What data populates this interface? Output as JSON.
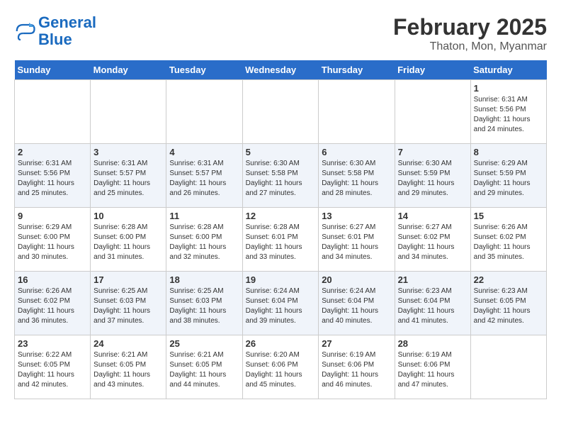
{
  "header": {
    "logo_line1": "General",
    "logo_line2": "Blue",
    "month": "February 2025",
    "location": "Thaton, Mon, Myanmar"
  },
  "days_of_week": [
    "Sunday",
    "Monday",
    "Tuesday",
    "Wednesday",
    "Thursday",
    "Friday",
    "Saturday"
  ],
  "weeks": [
    [
      {
        "day": "",
        "info": ""
      },
      {
        "day": "",
        "info": ""
      },
      {
        "day": "",
        "info": ""
      },
      {
        "day": "",
        "info": ""
      },
      {
        "day": "",
        "info": ""
      },
      {
        "day": "",
        "info": ""
      },
      {
        "day": "1",
        "info": "Sunrise: 6:31 AM\nSunset: 5:56 PM\nDaylight: 11 hours and 24 minutes."
      }
    ],
    [
      {
        "day": "2",
        "info": "Sunrise: 6:31 AM\nSunset: 5:56 PM\nDaylight: 11 hours and 25 minutes."
      },
      {
        "day": "3",
        "info": "Sunrise: 6:31 AM\nSunset: 5:57 PM\nDaylight: 11 hours and 25 minutes."
      },
      {
        "day": "4",
        "info": "Sunrise: 6:31 AM\nSunset: 5:57 PM\nDaylight: 11 hours and 26 minutes."
      },
      {
        "day": "5",
        "info": "Sunrise: 6:30 AM\nSunset: 5:58 PM\nDaylight: 11 hours and 27 minutes."
      },
      {
        "day": "6",
        "info": "Sunrise: 6:30 AM\nSunset: 5:58 PM\nDaylight: 11 hours and 28 minutes."
      },
      {
        "day": "7",
        "info": "Sunrise: 6:30 AM\nSunset: 5:59 PM\nDaylight: 11 hours and 29 minutes."
      },
      {
        "day": "8",
        "info": "Sunrise: 6:29 AM\nSunset: 5:59 PM\nDaylight: 11 hours and 29 minutes."
      }
    ],
    [
      {
        "day": "9",
        "info": "Sunrise: 6:29 AM\nSunset: 6:00 PM\nDaylight: 11 hours and 30 minutes."
      },
      {
        "day": "10",
        "info": "Sunrise: 6:28 AM\nSunset: 6:00 PM\nDaylight: 11 hours and 31 minutes."
      },
      {
        "day": "11",
        "info": "Sunrise: 6:28 AM\nSunset: 6:00 PM\nDaylight: 11 hours and 32 minutes."
      },
      {
        "day": "12",
        "info": "Sunrise: 6:28 AM\nSunset: 6:01 PM\nDaylight: 11 hours and 33 minutes."
      },
      {
        "day": "13",
        "info": "Sunrise: 6:27 AM\nSunset: 6:01 PM\nDaylight: 11 hours and 34 minutes."
      },
      {
        "day": "14",
        "info": "Sunrise: 6:27 AM\nSunset: 6:02 PM\nDaylight: 11 hours and 34 minutes."
      },
      {
        "day": "15",
        "info": "Sunrise: 6:26 AM\nSunset: 6:02 PM\nDaylight: 11 hours and 35 minutes."
      }
    ],
    [
      {
        "day": "16",
        "info": "Sunrise: 6:26 AM\nSunset: 6:02 PM\nDaylight: 11 hours and 36 minutes."
      },
      {
        "day": "17",
        "info": "Sunrise: 6:25 AM\nSunset: 6:03 PM\nDaylight: 11 hours and 37 minutes."
      },
      {
        "day": "18",
        "info": "Sunrise: 6:25 AM\nSunset: 6:03 PM\nDaylight: 11 hours and 38 minutes."
      },
      {
        "day": "19",
        "info": "Sunrise: 6:24 AM\nSunset: 6:04 PM\nDaylight: 11 hours and 39 minutes."
      },
      {
        "day": "20",
        "info": "Sunrise: 6:24 AM\nSunset: 6:04 PM\nDaylight: 11 hours and 40 minutes."
      },
      {
        "day": "21",
        "info": "Sunrise: 6:23 AM\nSunset: 6:04 PM\nDaylight: 11 hours and 41 minutes."
      },
      {
        "day": "22",
        "info": "Sunrise: 6:23 AM\nSunset: 6:05 PM\nDaylight: 11 hours and 42 minutes."
      }
    ],
    [
      {
        "day": "23",
        "info": "Sunrise: 6:22 AM\nSunset: 6:05 PM\nDaylight: 11 hours and 42 minutes."
      },
      {
        "day": "24",
        "info": "Sunrise: 6:21 AM\nSunset: 6:05 PM\nDaylight: 11 hours and 43 minutes."
      },
      {
        "day": "25",
        "info": "Sunrise: 6:21 AM\nSunset: 6:05 PM\nDaylight: 11 hours and 44 minutes."
      },
      {
        "day": "26",
        "info": "Sunrise: 6:20 AM\nSunset: 6:06 PM\nDaylight: 11 hours and 45 minutes."
      },
      {
        "day": "27",
        "info": "Sunrise: 6:19 AM\nSunset: 6:06 PM\nDaylight: 11 hours and 46 minutes."
      },
      {
        "day": "28",
        "info": "Sunrise: 6:19 AM\nSunset: 6:06 PM\nDaylight: 11 hours and 47 minutes."
      },
      {
        "day": "",
        "info": ""
      }
    ]
  ]
}
